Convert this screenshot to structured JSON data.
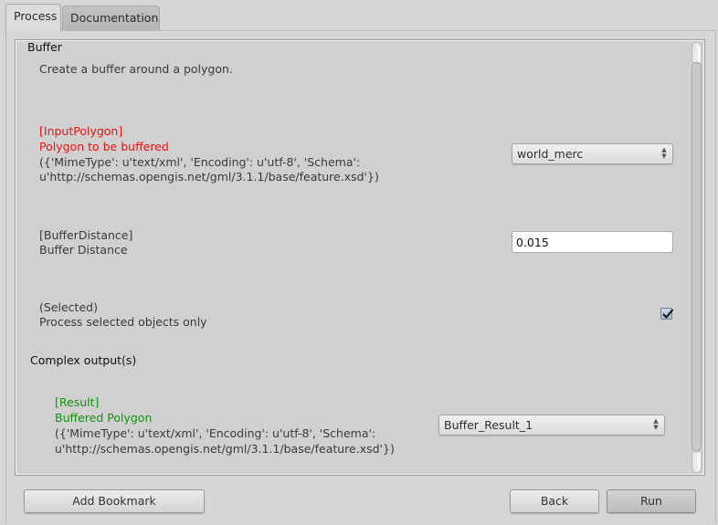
{
  "tabs": [
    {
      "label": "Process",
      "active": true
    },
    {
      "label": "Documentation",
      "active": false
    }
  ],
  "process": {
    "title": "Buffer",
    "abstract": "Create a buffer around a polygon.",
    "inputs": [
      {
        "identifier": "[InputPolygon]",
        "title": "Polygon to be buffered",
        "format_line1": "({'MimeType': u'text/xml', 'Encoding': u'utf-8', 'Schema':",
        "format_line2": "u'http://schemas.opengis.net/gml/3.1.1/base/feature.xsd'})",
        "widget": "combobox",
        "value": "world_merc",
        "label_color": "#ee1111"
      },
      {
        "identifier": "[BufferDistance]",
        "title": "Buffer Distance",
        "widget": "lineedit",
        "value": "0.015"
      },
      {
        "identifier": "(Selected)",
        "title": "Process selected objects only",
        "widget": "checkbox",
        "checked": true
      }
    ],
    "complex_outputs_title": "Complex output(s)",
    "outputs": [
      {
        "identifier": "[Result]",
        "title": "Buffered Polygon",
        "format_line1": "({'MimeType': u'text/xml', 'Encoding': u'utf-8', 'Schema':",
        "format_line2": "u'http://schemas.opengis.net/gml/3.1.1/base/feature.xsd'})",
        "widget": "combobox",
        "value": "Buffer_Result_1",
        "label_color": "#139013"
      }
    ]
  },
  "buttons": {
    "add_bookmark": "Add Bookmark",
    "back": "Back",
    "run": "Run"
  },
  "icons": {
    "combo_arrows": "updown-arrows-icon",
    "check": "checkmark-icon"
  }
}
